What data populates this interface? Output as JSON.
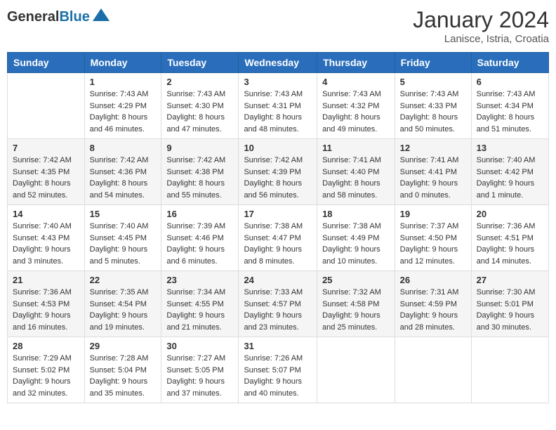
{
  "header": {
    "logo_general": "General",
    "logo_blue": "Blue",
    "month_year": "January 2024",
    "location": "Lanisce, Istria, Croatia"
  },
  "columns": [
    "Sunday",
    "Monday",
    "Tuesday",
    "Wednesday",
    "Thursday",
    "Friday",
    "Saturday"
  ],
  "weeks": [
    [
      {
        "day": "",
        "sunrise": "",
        "sunset": "",
        "daylight": ""
      },
      {
        "day": "1",
        "sunrise": "Sunrise: 7:43 AM",
        "sunset": "Sunset: 4:29 PM",
        "daylight": "Daylight: 8 hours and 46 minutes."
      },
      {
        "day": "2",
        "sunrise": "Sunrise: 7:43 AM",
        "sunset": "Sunset: 4:30 PM",
        "daylight": "Daylight: 8 hours and 47 minutes."
      },
      {
        "day": "3",
        "sunrise": "Sunrise: 7:43 AM",
        "sunset": "Sunset: 4:31 PM",
        "daylight": "Daylight: 8 hours and 48 minutes."
      },
      {
        "day": "4",
        "sunrise": "Sunrise: 7:43 AM",
        "sunset": "Sunset: 4:32 PM",
        "daylight": "Daylight: 8 hours and 49 minutes."
      },
      {
        "day": "5",
        "sunrise": "Sunrise: 7:43 AM",
        "sunset": "Sunset: 4:33 PM",
        "daylight": "Daylight: 8 hours and 50 minutes."
      },
      {
        "day": "6",
        "sunrise": "Sunrise: 7:43 AM",
        "sunset": "Sunset: 4:34 PM",
        "daylight": "Daylight: 8 hours and 51 minutes."
      }
    ],
    [
      {
        "day": "7",
        "sunrise": "Sunrise: 7:42 AM",
        "sunset": "Sunset: 4:35 PM",
        "daylight": "Daylight: 8 hours and 52 minutes."
      },
      {
        "day": "8",
        "sunrise": "Sunrise: 7:42 AM",
        "sunset": "Sunset: 4:36 PM",
        "daylight": "Daylight: 8 hours and 54 minutes."
      },
      {
        "day": "9",
        "sunrise": "Sunrise: 7:42 AM",
        "sunset": "Sunset: 4:38 PM",
        "daylight": "Daylight: 8 hours and 55 minutes."
      },
      {
        "day": "10",
        "sunrise": "Sunrise: 7:42 AM",
        "sunset": "Sunset: 4:39 PM",
        "daylight": "Daylight: 8 hours and 56 minutes."
      },
      {
        "day": "11",
        "sunrise": "Sunrise: 7:41 AM",
        "sunset": "Sunset: 4:40 PM",
        "daylight": "Daylight: 8 hours and 58 minutes."
      },
      {
        "day": "12",
        "sunrise": "Sunrise: 7:41 AM",
        "sunset": "Sunset: 4:41 PM",
        "daylight": "Daylight: 9 hours and 0 minutes."
      },
      {
        "day": "13",
        "sunrise": "Sunrise: 7:40 AM",
        "sunset": "Sunset: 4:42 PM",
        "daylight": "Daylight: 9 hours and 1 minute."
      }
    ],
    [
      {
        "day": "14",
        "sunrise": "Sunrise: 7:40 AM",
        "sunset": "Sunset: 4:43 PM",
        "daylight": "Daylight: 9 hours and 3 minutes."
      },
      {
        "day": "15",
        "sunrise": "Sunrise: 7:40 AM",
        "sunset": "Sunset: 4:45 PM",
        "daylight": "Daylight: 9 hours and 5 minutes."
      },
      {
        "day": "16",
        "sunrise": "Sunrise: 7:39 AM",
        "sunset": "Sunset: 4:46 PM",
        "daylight": "Daylight: 9 hours and 6 minutes."
      },
      {
        "day": "17",
        "sunrise": "Sunrise: 7:38 AM",
        "sunset": "Sunset: 4:47 PM",
        "daylight": "Daylight: 9 hours and 8 minutes."
      },
      {
        "day": "18",
        "sunrise": "Sunrise: 7:38 AM",
        "sunset": "Sunset: 4:49 PM",
        "daylight": "Daylight: 9 hours and 10 minutes."
      },
      {
        "day": "19",
        "sunrise": "Sunrise: 7:37 AM",
        "sunset": "Sunset: 4:50 PM",
        "daylight": "Daylight: 9 hours and 12 minutes."
      },
      {
        "day": "20",
        "sunrise": "Sunrise: 7:36 AM",
        "sunset": "Sunset: 4:51 PM",
        "daylight": "Daylight: 9 hours and 14 minutes."
      }
    ],
    [
      {
        "day": "21",
        "sunrise": "Sunrise: 7:36 AM",
        "sunset": "Sunset: 4:53 PM",
        "daylight": "Daylight: 9 hours and 16 minutes."
      },
      {
        "day": "22",
        "sunrise": "Sunrise: 7:35 AM",
        "sunset": "Sunset: 4:54 PM",
        "daylight": "Daylight: 9 hours and 19 minutes."
      },
      {
        "day": "23",
        "sunrise": "Sunrise: 7:34 AM",
        "sunset": "Sunset: 4:55 PM",
        "daylight": "Daylight: 9 hours and 21 minutes."
      },
      {
        "day": "24",
        "sunrise": "Sunrise: 7:33 AM",
        "sunset": "Sunset: 4:57 PM",
        "daylight": "Daylight: 9 hours and 23 minutes."
      },
      {
        "day": "25",
        "sunrise": "Sunrise: 7:32 AM",
        "sunset": "Sunset: 4:58 PM",
        "daylight": "Daylight: 9 hours and 25 minutes."
      },
      {
        "day": "26",
        "sunrise": "Sunrise: 7:31 AM",
        "sunset": "Sunset: 4:59 PM",
        "daylight": "Daylight: 9 hours and 28 minutes."
      },
      {
        "day": "27",
        "sunrise": "Sunrise: 7:30 AM",
        "sunset": "Sunset: 5:01 PM",
        "daylight": "Daylight: 9 hours and 30 minutes."
      }
    ],
    [
      {
        "day": "28",
        "sunrise": "Sunrise: 7:29 AM",
        "sunset": "Sunset: 5:02 PM",
        "daylight": "Daylight: 9 hours and 32 minutes."
      },
      {
        "day": "29",
        "sunrise": "Sunrise: 7:28 AM",
        "sunset": "Sunset: 5:04 PM",
        "daylight": "Daylight: 9 hours and 35 minutes."
      },
      {
        "day": "30",
        "sunrise": "Sunrise: 7:27 AM",
        "sunset": "Sunset: 5:05 PM",
        "daylight": "Daylight: 9 hours and 37 minutes."
      },
      {
        "day": "31",
        "sunrise": "Sunrise: 7:26 AM",
        "sunset": "Sunset: 5:07 PM",
        "daylight": "Daylight: 9 hours and 40 minutes."
      },
      {
        "day": "",
        "sunrise": "",
        "sunset": "",
        "daylight": ""
      },
      {
        "day": "",
        "sunrise": "",
        "sunset": "",
        "daylight": ""
      },
      {
        "day": "",
        "sunrise": "",
        "sunset": "",
        "daylight": ""
      }
    ]
  ]
}
